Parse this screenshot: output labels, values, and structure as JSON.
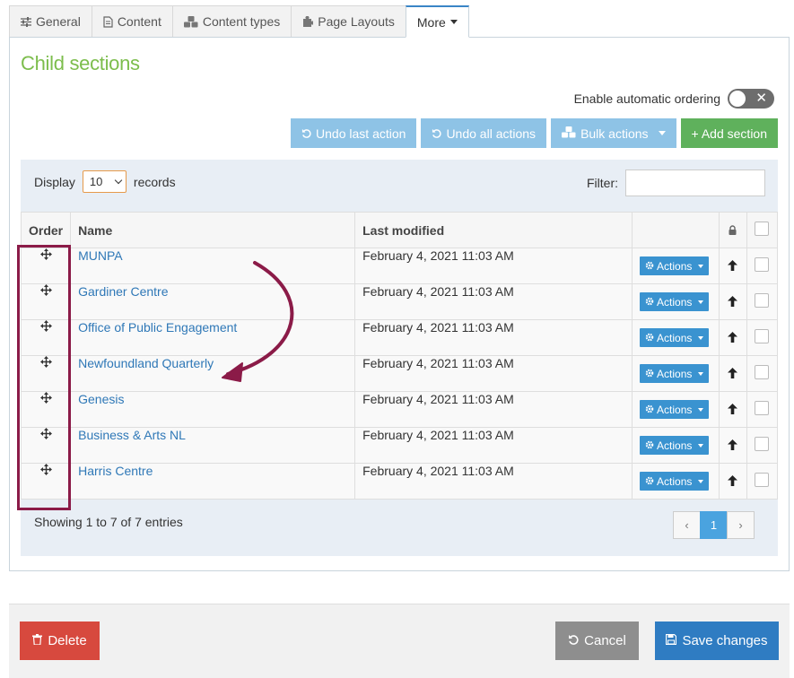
{
  "tabs": [
    {
      "label": "General",
      "icon": "sliders-icon"
    },
    {
      "label": "Content",
      "icon": "document-icon"
    },
    {
      "label": "Content types",
      "icon": "cubes-icon"
    },
    {
      "label": "Page Layouts",
      "icon": "puzzle-icon"
    },
    {
      "label": "More",
      "icon": "caret-down-icon",
      "active": true
    }
  ],
  "section": {
    "title": "Child sections",
    "auto_ordering_label": "Enable automatic ordering",
    "auto_ordering_enabled": false
  },
  "toolbar": {
    "undo_last": "Undo last action",
    "undo_all": "Undo all actions",
    "bulk_actions": "Bulk actions",
    "add_section": "+ Add section"
  },
  "table": {
    "display_label": "Display",
    "display_value": "10",
    "records_label": "records",
    "filter_label": "Filter:",
    "filter_value": "",
    "headers": {
      "order": "Order",
      "name": "Name",
      "last_modified": "Last modified"
    },
    "actions_label": "Actions",
    "rows": [
      {
        "name": "MUNPA",
        "modified": "February 4, 2021 11:03 AM"
      },
      {
        "name": "Gardiner Centre",
        "modified": "February 4, 2021 11:03 AM"
      },
      {
        "name": "Office of Public Engagement",
        "modified": "February 4, 2021 11:03 AM"
      },
      {
        "name": "Newfoundland Quarterly",
        "modified": "February 4, 2021 11:03 AM"
      },
      {
        "name": "Genesis",
        "modified": "February 4, 2021 11:03 AM"
      },
      {
        "name": "Business & Arts NL",
        "modified": "February 4, 2021 11:03 AM"
      },
      {
        "name": "Harris Centre",
        "modified": "February 4, 2021 11:03 AM"
      }
    ],
    "showing": "Showing 1 to 7 of 7 entries",
    "pagination": {
      "prev": "‹",
      "current": "1",
      "next": "›"
    }
  },
  "footer": {
    "delete": "Delete",
    "cancel": "Cancel",
    "save": "Save changes"
  },
  "colors": {
    "title_green": "#7cbd4c",
    "annotation": "#8b1b48",
    "link_blue": "#2f78b7",
    "delete_red": "#d7493e",
    "save_blue": "#2f7cc2"
  }
}
